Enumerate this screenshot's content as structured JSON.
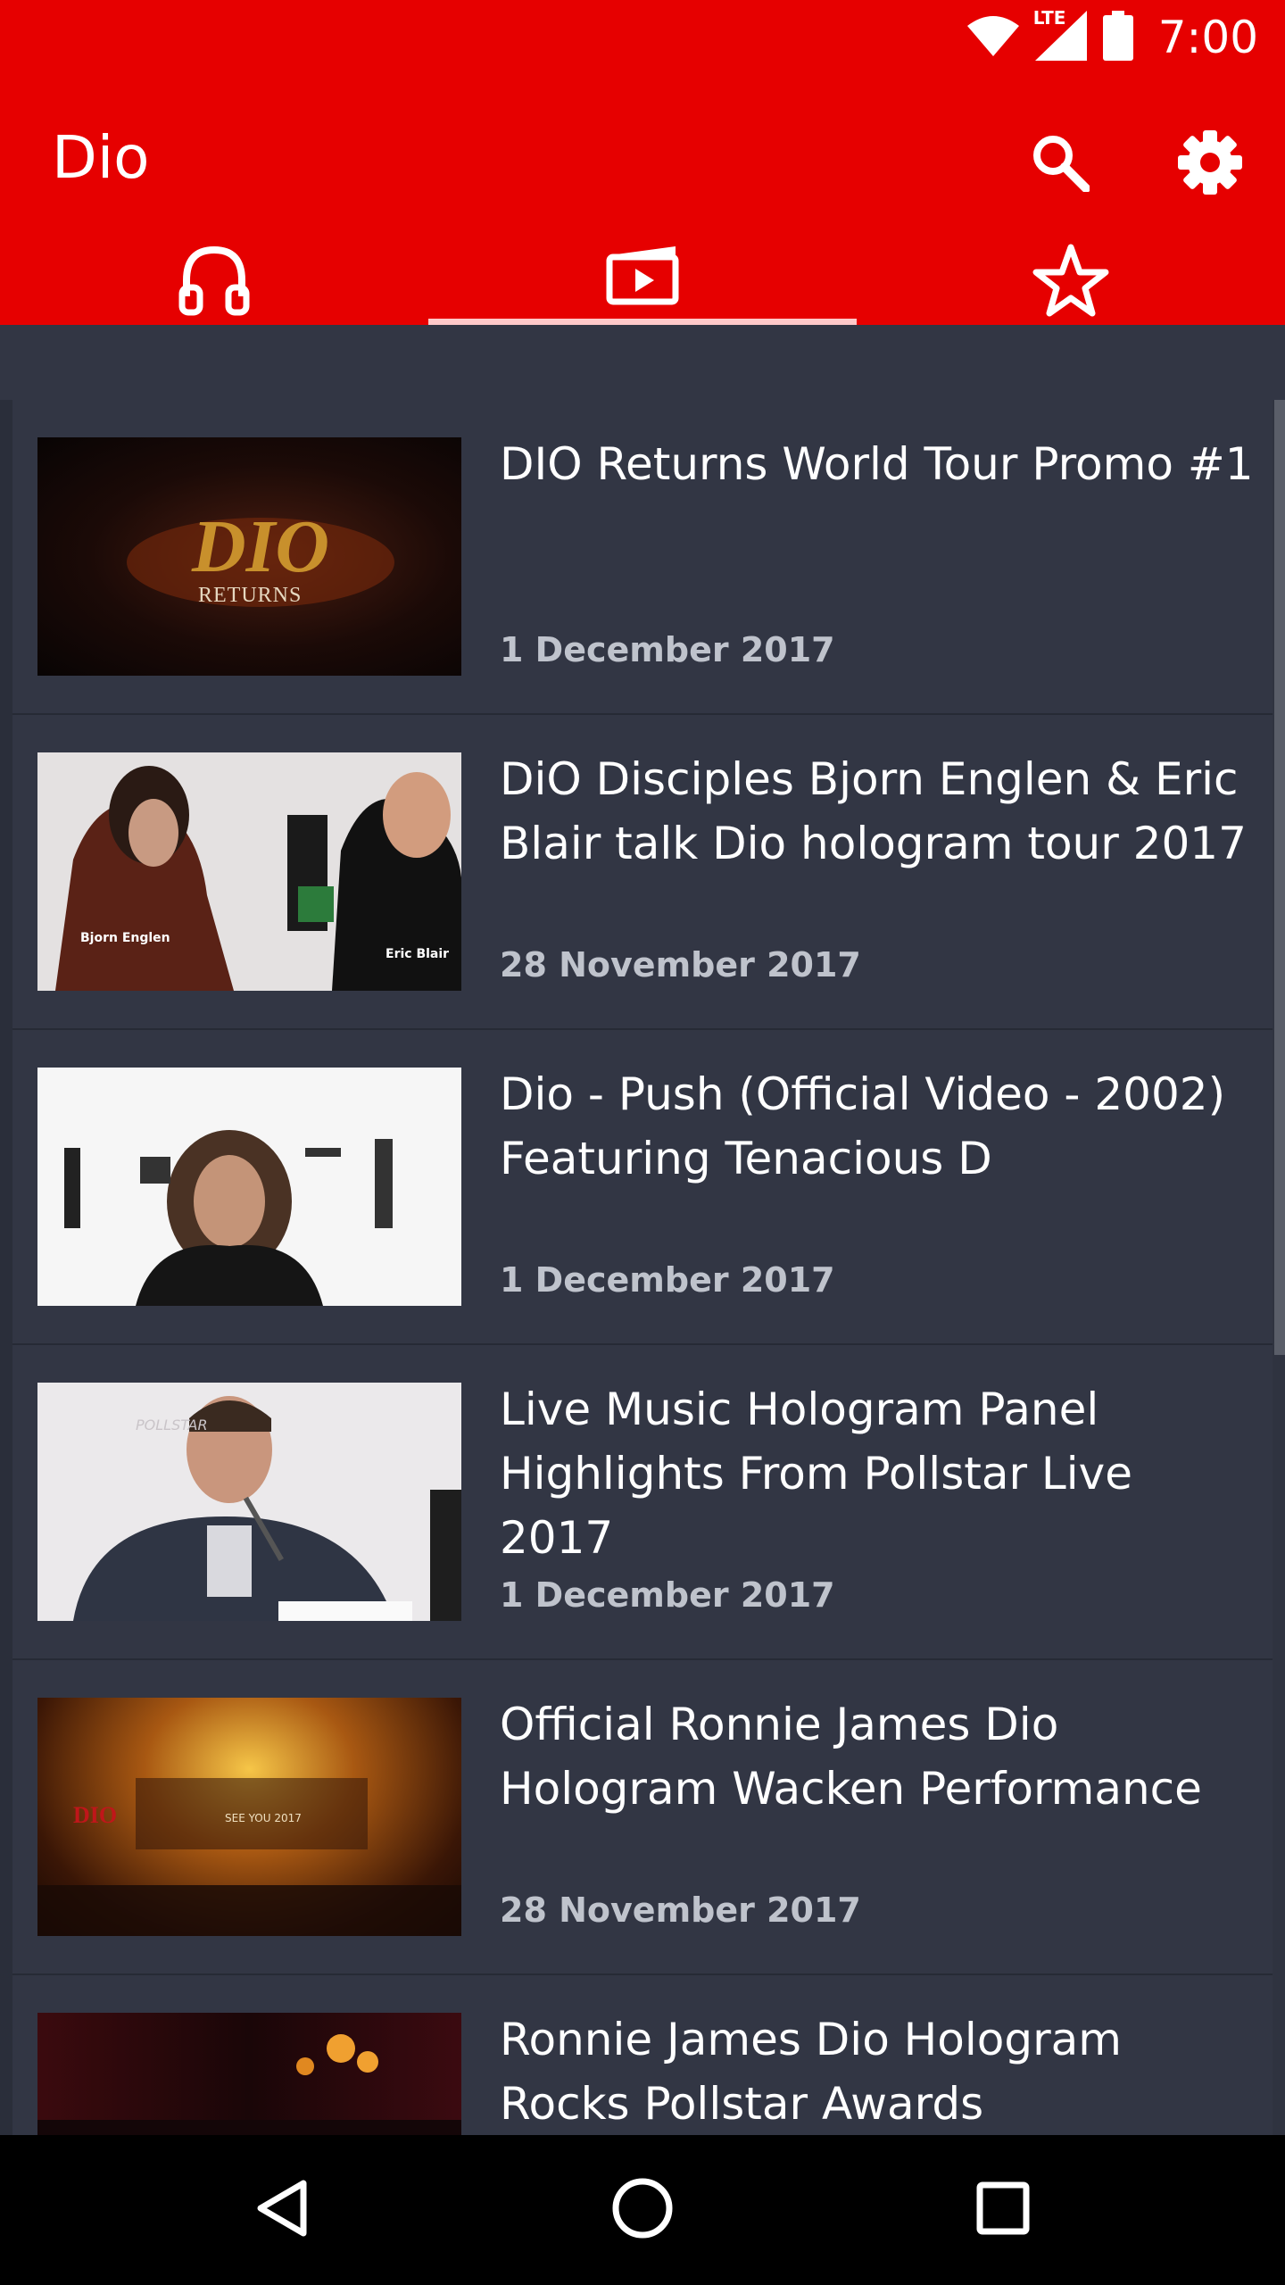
{
  "status": {
    "time": "7:00",
    "network": "LTE"
  },
  "app": {
    "title": "Dio"
  },
  "tabs": [
    {
      "name": "audio",
      "icon": "headphones-icon"
    },
    {
      "name": "videos",
      "icon": "video-icon",
      "selected": true
    },
    {
      "name": "favorites",
      "icon": "star-icon"
    }
  ],
  "videos": [
    {
      "title": "DIO Returns World Tour Promo #1",
      "date": "1 December 2017",
      "thumb_text": "RETURNS"
    },
    {
      "title": "DiO Disciples Bjorn Englen  & Eric Blair talk Dio hologram tour 2017",
      "date": "28 November 2017",
      "thumb_text": "Bjorn Englen",
      "thumb_text2": "Eric Blair"
    },
    {
      "title": "Dio - Push (Official Video - 2002) Featuring Tenacious D",
      "date": "1 December 2017"
    },
    {
      "title": "Live Music Hologram Panel Highlights From Pollstar Live 2017",
      "date": "1 December 2017",
      "thumb_text": "POLLSTAR"
    },
    {
      "title": "Official Ronnie James Dio Hologram Wacken Performance",
      "date": "28 November 2017",
      "thumb_text": "SEE YOU 2017"
    },
    {
      "title": "Ronnie James Dio Hologram Rocks Pollstar Awards",
      "date": ""
    }
  ],
  "colors": {
    "primary": "#E60000",
    "background": "#323644",
    "indicator": "#FFC9C9"
  }
}
